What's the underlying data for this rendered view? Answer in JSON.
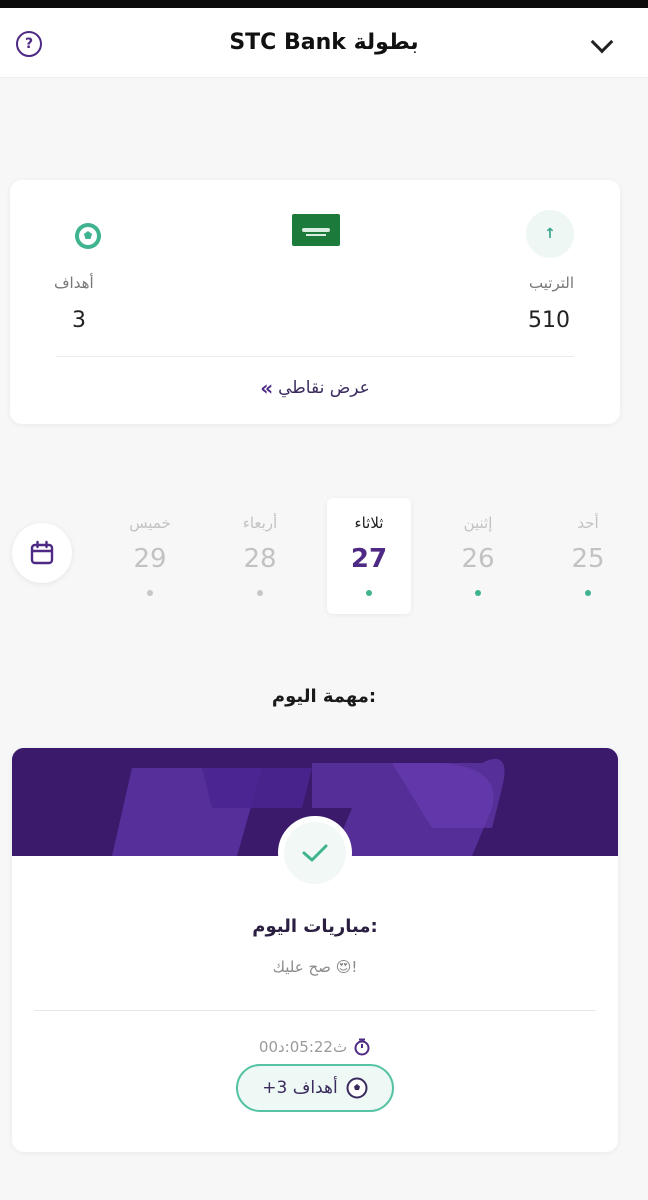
{
  "header": {
    "title": "STC Bank بطولة",
    "help_icon": "help-circle-icon",
    "collapse_icon": "chevron-down-icon"
  },
  "stats": {
    "rank_label": "الترتيب",
    "rank_value": "510",
    "goals_label": "أهداف",
    "goals_value": "3",
    "points_link": "عرض نقاطي",
    "flag": "saudi-flag-icon"
  },
  "days": [
    {
      "name": "أحد",
      "number": "25",
      "dot": "green"
    },
    {
      "name": "إثنين",
      "number": "26",
      "dot": "green"
    },
    {
      "name": "ثلاثاء",
      "number": "27",
      "dot": "green",
      "active": true
    },
    {
      "name": "أربعاء",
      "number": "28",
      "dot": "gray"
    },
    {
      "name": "خميس",
      "number": "29",
      "dot": "gray"
    }
  ],
  "task": {
    "section_title": "مهمة اليوم:",
    "title": "مباريات اليوم:",
    "subtitle": "صح عليك 😍!",
    "timer": "ث05:22:د00",
    "reward": "+3 أهداف"
  },
  "colors": {
    "brand_purple": "#4e2a84",
    "accent_green": "#3fb38f",
    "banner": "#3b1a6b"
  }
}
